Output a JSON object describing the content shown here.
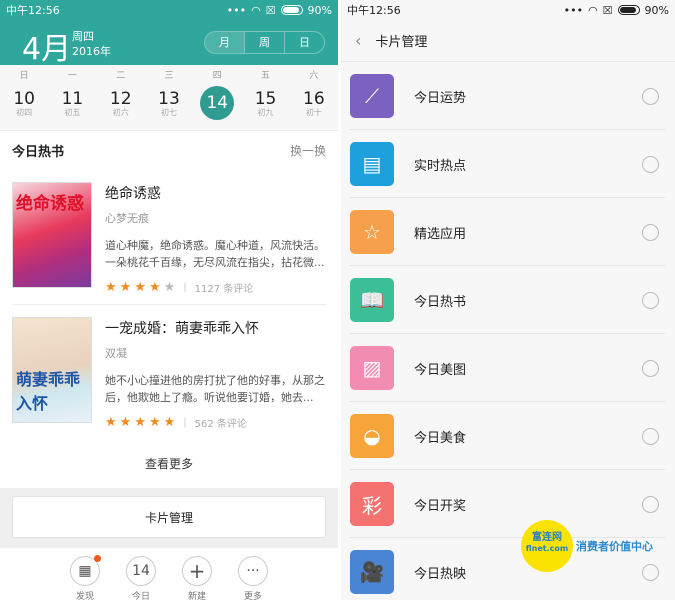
{
  "left": {
    "status": {
      "time": "中午12:56",
      "battery": "90%"
    },
    "header": {
      "month": "4月",
      "weekday": "周四",
      "year": "2016年",
      "views": [
        "月",
        "周",
        "日"
      ]
    },
    "weekdays": [
      "日",
      "一",
      "二",
      "三",
      "四",
      "五",
      "六"
    ],
    "dates": [
      {
        "n": "10",
        "l": "初四"
      },
      {
        "n": "11",
        "l": "初五"
      },
      {
        "n": "12",
        "l": "初六"
      },
      {
        "n": "13",
        "l": "初七"
      },
      {
        "n": "14",
        "l": ""
      },
      {
        "n": "15",
        "l": "初九"
      },
      {
        "n": "16",
        "l": "初十"
      }
    ],
    "section": {
      "title": "今日热书",
      "action": "换一换"
    },
    "books": [
      {
        "title": "绝命诱惑",
        "author": "心梦无痕",
        "desc": "道心种魔，绝命诱惑。魔心种道，风流快活。一朵桃花千百缘，无尽风流在指尖，拈花微...",
        "rating": 4,
        "reviews": "1127 条评论",
        "cover_text": "绝命诱惑"
      },
      {
        "title": "一宠成婚：萌妻乖乖入怀",
        "author": "双凝",
        "desc": "她不小心撞进他的房打扰了他的好事，从那之后，他欺她上了瘾。听说他要订婚，她去...",
        "rating": 4.5,
        "reviews": "562 条评论",
        "cover_text": "萌妻乖乖入怀"
      }
    ],
    "more": "查看更多",
    "card_manage": "卡片管理",
    "nav": [
      {
        "label": "发现",
        "icon": "grid-icon"
      },
      {
        "label": "今日",
        "icon": "14"
      },
      {
        "label": "新建",
        "icon": "plus-icon"
      },
      {
        "label": "更多",
        "icon": "more-icon"
      }
    ]
  },
  "right": {
    "status": {
      "time": "中午12:56",
      "battery": "90%"
    },
    "title": "卡片管理",
    "items": [
      {
        "label": "今日运势",
        "color": "#7b62c0",
        "glyph": "⟋"
      },
      {
        "label": "实时热点",
        "color": "#1ea0dc",
        "glyph": "▤"
      },
      {
        "label": "精选应用",
        "color": "#f7a04c",
        "glyph": "☆"
      },
      {
        "label": "今日热书",
        "color": "#3cbf98",
        "glyph": "📖"
      },
      {
        "label": "今日美图",
        "color": "#f28cb3",
        "glyph": "▨"
      },
      {
        "label": "今日美食",
        "color": "#f7a43a",
        "glyph": "◒"
      },
      {
        "label": "今日开奖",
        "color": "#f47270",
        "glyph": "彩"
      },
      {
        "label": "今日热映",
        "color": "#4a85d4",
        "glyph": "🎥"
      }
    ],
    "watermark": {
      "name": "富连网",
      "domain": "flnet.com",
      "slogan": "消费者价值中心"
    }
  }
}
